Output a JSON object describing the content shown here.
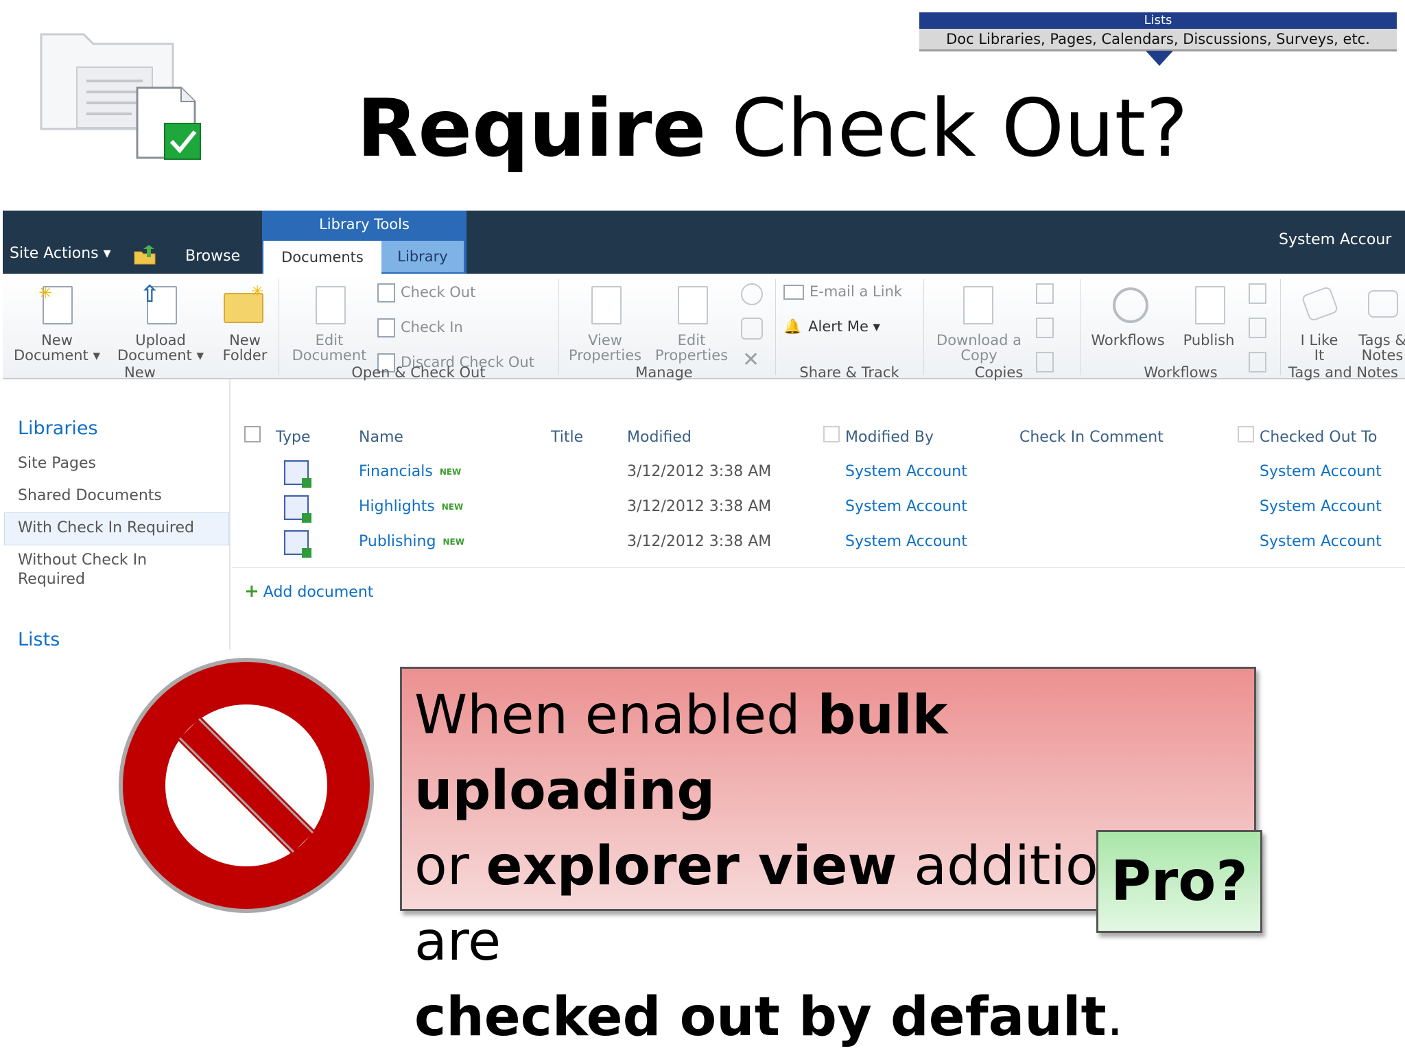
{
  "banner": {
    "title": "Lists",
    "subtitle": "Doc Libraries, Pages, Calendars, Discussions, Surveys, etc."
  },
  "slide": {
    "title_bold": "Require",
    "title_rest": " Check Out?"
  },
  "topbar": {
    "site_actions": "Site Actions ▾",
    "browse": "Browse",
    "library_tools": "Library Tools",
    "tab_documents": "Documents",
    "tab_library": "Library",
    "user": "System Accour"
  },
  "ribbon": {
    "new_document": [
      "New",
      "Document ▾"
    ],
    "upload_document": [
      "Upload",
      "Document ▾"
    ],
    "new_folder": [
      "New",
      "Folder"
    ],
    "group_new": "New",
    "edit_document": [
      "Edit",
      "Document"
    ],
    "check_out": "Check Out",
    "check_in": "Check In",
    "discard_check_out": "Discard Check Out",
    "group_open": "Open & Check Out",
    "view_properties": [
      "View",
      "Properties"
    ],
    "edit_properties": [
      "Edit",
      "Properties"
    ],
    "group_manage": "Manage",
    "email_link": "E-mail a Link",
    "alert_me": "Alert Me ▾",
    "group_share": "Share & Track",
    "download_copy": [
      "Download a",
      "Copy"
    ],
    "group_copies": "Copies",
    "workflows": "Workflows",
    "publish": "Publish",
    "group_workflows": "Workflows",
    "i_like_it": [
      "I Like",
      "It"
    ],
    "tags_notes": [
      "Tags &",
      "Notes"
    ],
    "group_tags": "Tags and Notes"
  },
  "leftnav": {
    "libraries": "Libraries",
    "items": [
      "Site Pages",
      "Shared Documents",
      "With Check In Required",
      "Without Check In",
      "Required"
    ],
    "lists": "Lists"
  },
  "list": {
    "columns": [
      "Type",
      "Name",
      "Title",
      "Modified",
      "Modified By",
      "Check In Comment",
      "Checked Out To"
    ],
    "new_tag": "NEW",
    "rows": [
      {
        "name": "Financials",
        "modified": "3/12/2012 3:38 AM",
        "modified_by": "System Account",
        "checked_out_to": "System Account"
      },
      {
        "name": "Highlights",
        "modified": "3/12/2012 3:38 AM",
        "modified_by": "System Account",
        "checked_out_to": "System Account"
      },
      {
        "name": "Publishing",
        "modified": "3/12/2012 3:38 AM",
        "modified_by": "System Account",
        "checked_out_to": "System Account"
      }
    ],
    "add_document": "Add document"
  },
  "callout": {
    "l1a": "When enabled ",
    "l1b": "bulk uploading",
    "l2a": "or ",
    "l2b": "explorer view",
    "l2c": " additions are",
    "l3a": "checked out by default",
    "l3b": ".",
    "pro": "Pro?"
  },
  "colors": {
    "topbar": "#21374c",
    "library_tools": "#2a6ab6",
    "link": "#0f6fc6",
    "no_sign": "#c00000",
    "callout": "#ec9090",
    "pro": "#a9e6a9"
  }
}
